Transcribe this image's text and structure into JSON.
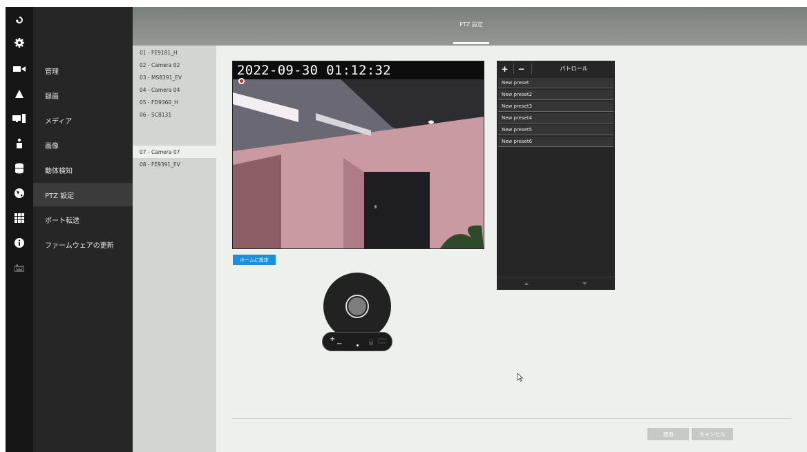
{
  "header": {
    "title": "PTZ 設定"
  },
  "rail": {
    "icons": [
      "nav-logo-icon",
      "settings-gear-icon",
      "camera-icon",
      "alert-icon",
      "device-icon",
      "user-icon",
      "storage-icon",
      "globe-icon",
      "grid-icon",
      "info-icon",
      "keyboard-icon"
    ]
  },
  "menu": {
    "items": [
      {
        "label": "管理"
      },
      {
        "label": "録画"
      },
      {
        "label": "メディア"
      },
      {
        "label": "画像"
      },
      {
        "label": "動体検知"
      },
      {
        "label": "PTZ 設定",
        "active": true
      },
      {
        "label": "ポート転送"
      },
      {
        "label": "ファームウェアの更新"
      }
    ]
  },
  "cameras": {
    "items": [
      {
        "label": "01 - FE9181_H"
      },
      {
        "label": "02 - Camera 02"
      },
      {
        "label": "03 - MS8391_EV"
      },
      {
        "label": "04 - Camera 04"
      },
      {
        "label": "05 - FD9360_H"
      },
      {
        "label": "06 - SC8131"
      },
      {
        "label": "07 - Camera 07",
        "active": true
      },
      {
        "label": "08 - FE9391_EV"
      }
    ]
  },
  "video": {
    "timestamp": "2022-09-30 01:12:32"
  },
  "ptz": {
    "home_button": "ホームに設定",
    "zoom_in": "+",
    "zoom_out": "−"
  },
  "presets": {
    "add": "+",
    "remove": "−",
    "title": "パトロール",
    "items": [
      {
        "label": "New preset"
      },
      {
        "label": "New preset2"
      },
      {
        "label": "New preset3"
      },
      {
        "label": "New preset4"
      },
      {
        "label": "New preset5"
      },
      {
        "label": "New preset6"
      }
    ]
  },
  "footer": {
    "apply": "適用",
    "cancel": "キャンセル"
  },
  "colors": {
    "accent": "#1d8fe0",
    "rec": "#d0202a"
  }
}
